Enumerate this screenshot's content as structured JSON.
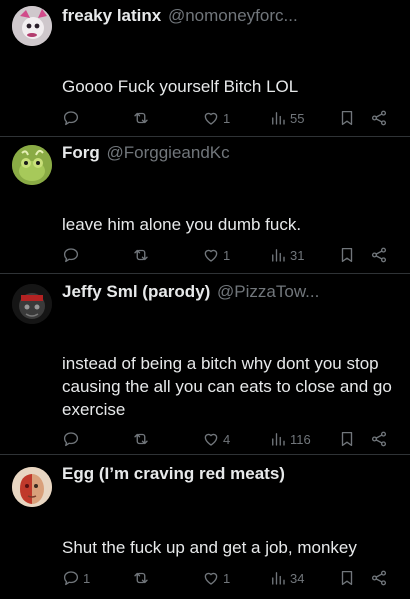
{
  "posts": [
    {
      "name": "freaky latinx",
      "handle": "@nomoneyforc...",
      "text": "Goooo Fuck yourself Bitch LOL",
      "replies": "",
      "likes": "1",
      "views": "55"
    },
    {
      "name": "Forg",
      "handle": "@ForggieandKc",
      "text": "leave him alone you dumb fuck.",
      "replies": "",
      "likes": "1",
      "views": "31"
    },
    {
      "name": "Jeffy Sml (parody)",
      "handle": "@PizzaTow...",
      "text": "instead of being a bitch why dont you stop causing the all you can eats to close and go exercise",
      "replies": "",
      "likes": "4",
      "views": "116"
    },
    {
      "name": "Egg (I’m craving red meats)",
      "handle": "",
      "text": "Shut the fuck up and get a job, monkey",
      "replies": "1",
      "likes": "1",
      "views": "34"
    }
  ],
  "icons": {
    "reply": "reply-icon",
    "repost": "repost-icon",
    "like": "heart-icon",
    "views": "views-icon",
    "bookmark": "bookmark-icon",
    "share": "share-icon"
  },
  "colors": {
    "background": "#000000",
    "text": "#e7e9ea",
    "muted": "#71767b",
    "separator": "#2f3336"
  }
}
